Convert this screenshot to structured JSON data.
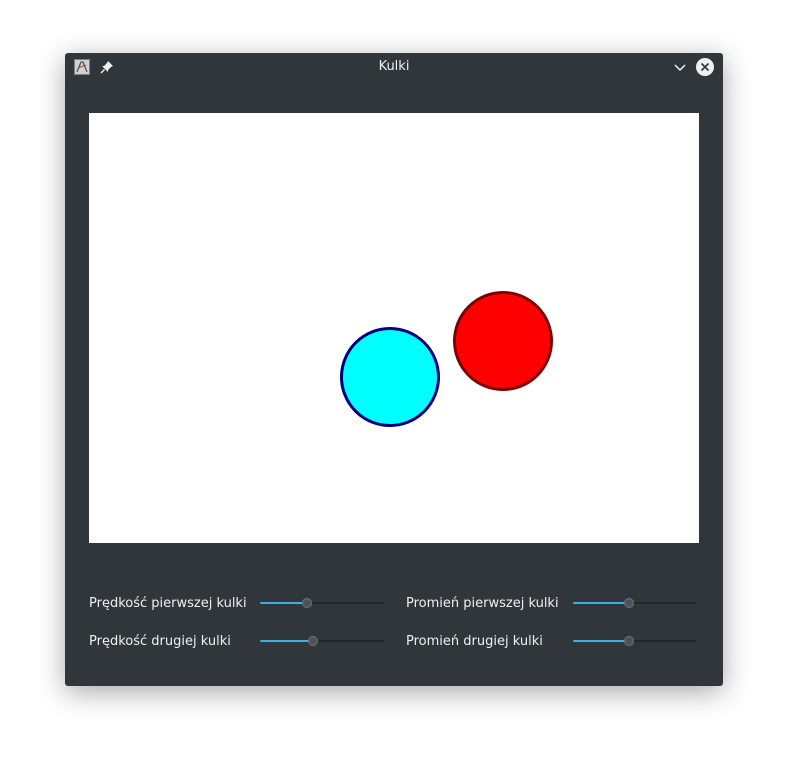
{
  "window": {
    "title": "Kulki"
  },
  "colors": {
    "ball1_fill": "#00ffff",
    "ball1_border": "#000080",
    "ball2_fill": "#ff0000",
    "ball2_border": "#800000",
    "slider_accent": "#3daee9"
  },
  "icons": {
    "app": "app-icon",
    "pin": "pin-icon",
    "minimize": "chevron-down-icon",
    "close": "close-icon"
  },
  "controls": {
    "speed1": {
      "label": "Prędkość pierwszej kulki",
      "value_fraction": 0.38
    },
    "speed2": {
      "label": "Prędkość drugiej kulki",
      "value_fraction": 0.43
    },
    "radius1": {
      "label": "Promień pierwszej kulki",
      "value_fraction": 0.45
    },
    "radius2": {
      "label": "Promień drugiej kulki",
      "value_fraction": 0.45
    }
  }
}
